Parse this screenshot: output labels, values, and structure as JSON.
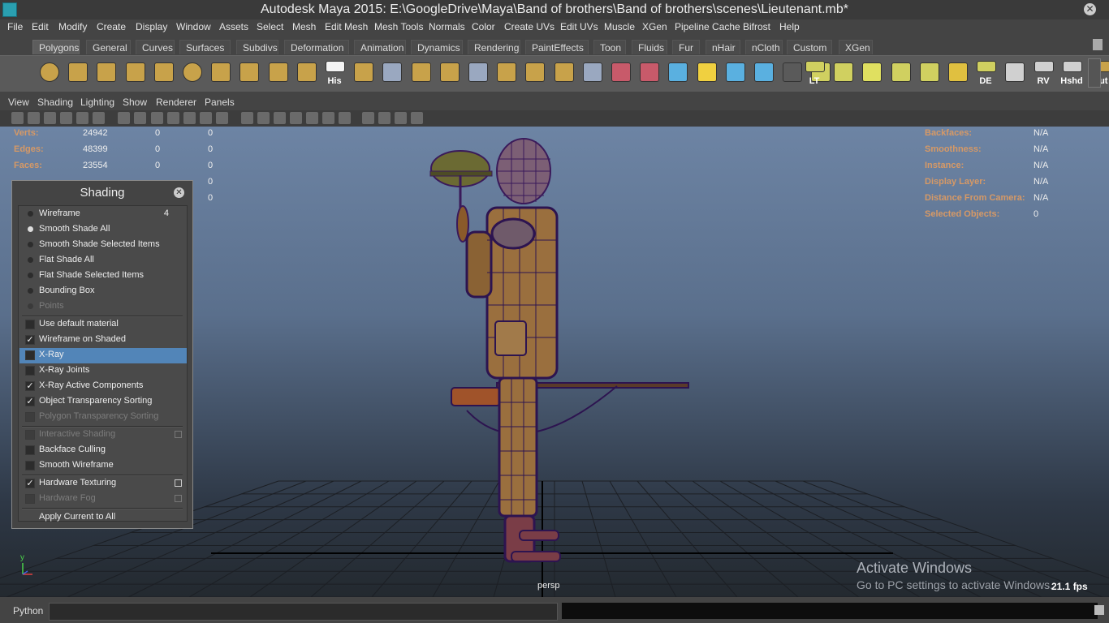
{
  "window": {
    "title": "Autodesk Maya 2015: E:\\GoogleDrive\\Maya\\Band of brothers\\Band of brothers\\scenes\\Lieutenant.mb*"
  },
  "menubar": [
    "File",
    "Edit",
    "Modify",
    "Create",
    "Display",
    "Window",
    "Assets",
    "Select",
    "Mesh",
    "Edit Mesh",
    "Mesh Tools",
    "Normals",
    "Color",
    "Create UVs",
    "Edit UVs",
    "Muscle",
    "XGen",
    "Pipeline Cache",
    "Bifrost",
    "Help"
  ],
  "shelf_tabs": {
    "active": "Polygons",
    "items": [
      "Polygons",
      "General",
      "Curves",
      "Surfaces",
      "Subdivs",
      "Deformation",
      "Animation",
      "Dynamics",
      "Rendering",
      "PaintEffects",
      "Toon",
      "Fluids",
      "Fur",
      "nHair",
      "nCloth",
      "Custom",
      "XGen"
    ]
  },
  "shelf_buttons": [
    {
      "icon": "poly-sphere-icon",
      "label": ""
    },
    {
      "icon": "poly-cube-icon",
      "label": ""
    },
    {
      "icon": "poly-cylinder-icon",
      "label": ""
    },
    {
      "icon": "poly-cone-icon",
      "label": ""
    },
    {
      "icon": "poly-plane-icon",
      "label": ""
    },
    {
      "icon": "poly-torus-icon",
      "label": ""
    },
    {
      "icon": "poly-pyramid-icon",
      "label": ""
    },
    {
      "icon": "poly-pipe-icon",
      "label": ""
    },
    {
      "icon": "create-polygon-icon",
      "label": ""
    },
    {
      "icon": "combine-icon",
      "label": ""
    },
    {
      "icon": "history-icon",
      "label": "His"
    },
    {
      "icon": "smooth-icon",
      "label": ""
    },
    {
      "icon": "extrude-icon",
      "label": ""
    },
    {
      "icon": "bridge-icon",
      "label": ""
    },
    {
      "icon": "append-icon",
      "label": ""
    },
    {
      "icon": "split-icon",
      "label": ""
    },
    {
      "icon": "insert-edge-loop-icon",
      "label": ""
    },
    {
      "icon": "offset-edge-icon",
      "label": ""
    },
    {
      "icon": "merge-icon",
      "label": ""
    },
    {
      "icon": "bevel-icon",
      "label": ""
    },
    {
      "icon": "poke-icon",
      "label": ""
    },
    {
      "icon": "wedge-icon",
      "label": ""
    },
    {
      "icon": "sculpt-icon",
      "label": ""
    },
    {
      "icon": "paint-icon",
      "label": ""
    },
    {
      "icon": "lattice-icon",
      "label": ""
    },
    {
      "icon": "pivot-icon",
      "label": ""
    },
    {
      "icon": "snap-icon",
      "label": ""
    },
    {
      "icon": "transfer-icon",
      "label": ""
    },
    {
      "icon": "lt-icon",
      "label": "LT"
    },
    {
      "icon": "uv-planar-icon",
      "label": ""
    },
    {
      "icon": "uv-cylindrical-icon",
      "label": ""
    },
    {
      "icon": "uv-spherical-icon",
      "label": ""
    },
    {
      "icon": "uv-auto-icon",
      "label": ""
    },
    {
      "icon": "uv-editor-icon",
      "label": ""
    },
    {
      "icon": "de-icon",
      "label": "DE"
    },
    {
      "icon": "uv-unfold-icon",
      "label": ""
    },
    {
      "icon": "rv-icon",
      "label": "RV"
    },
    {
      "icon": "hshd-icon",
      "label": "Hshd"
    },
    {
      "icon": "out-icon",
      "label": "Out"
    }
  ],
  "panel_menu": [
    "View",
    "Shading",
    "Lighting",
    "Show",
    "Renderer",
    "Panels"
  ],
  "hud_left": [
    {
      "label": "Verts:",
      "v1": "24942",
      "v2": "0",
      "v3": "0"
    },
    {
      "label": "Edges:",
      "v1": "48399",
      "v2": "0",
      "v3": "0"
    },
    {
      "label": "Faces:",
      "v1": "23554",
      "v2": "0",
      "v3": "0"
    },
    {
      "label": "",
      "v1": "",
      "v2": "",
      "v3": "0"
    },
    {
      "label": "",
      "v1": "",
      "v2": "",
      "v3": "0"
    }
  ],
  "hud_right": [
    {
      "label": "Backfaces:",
      "value": "N/A"
    },
    {
      "label": "Smoothness:",
      "value": "N/A"
    },
    {
      "label": "Instance:",
      "value": "N/A"
    },
    {
      "label": "Display Layer:",
      "value": "N/A"
    },
    {
      "label": "Distance From Camera:",
      "value": "N/A"
    },
    {
      "label": "Selected Objects:",
      "value": "0"
    }
  ],
  "shading_panel": {
    "title": "Shading",
    "radios": [
      {
        "label": "Wireframe",
        "hotkey": "4",
        "on": false,
        "disabled": false
      },
      {
        "label": "Smooth Shade All",
        "hotkey": "",
        "on": true,
        "disabled": false
      },
      {
        "label": "Smooth Shade Selected Items",
        "hotkey": "",
        "on": false,
        "disabled": false
      },
      {
        "label": "Flat Shade All",
        "hotkey": "",
        "on": false,
        "disabled": false
      },
      {
        "label": "Flat Shade Selected Items",
        "hotkey": "",
        "on": false,
        "disabled": false
      },
      {
        "label": "Bounding Box",
        "hotkey": "",
        "on": false,
        "disabled": false
      },
      {
        "label": "Points",
        "hotkey": "",
        "on": false,
        "disabled": true
      }
    ],
    "checks_a": [
      {
        "label": "Use default material",
        "checked": false,
        "disabled": false,
        "selected": false
      },
      {
        "label": "Wireframe on Shaded",
        "checked": true,
        "disabled": false,
        "selected": false
      },
      {
        "label": "X-Ray",
        "checked": false,
        "disabled": false,
        "selected": true
      },
      {
        "label": "X-Ray Joints",
        "checked": false,
        "disabled": false,
        "selected": false
      },
      {
        "label": "X-Ray Active Components",
        "checked": true,
        "disabled": false,
        "selected": false
      },
      {
        "label": "Object Transparency Sorting",
        "checked": true,
        "disabled": false,
        "selected": false
      },
      {
        "label": "Polygon Transparency Sorting",
        "checked": false,
        "disabled": true,
        "selected": false
      }
    ],
    "checks_b": [
      {
        "label": "Interactive Shading",
        "checked": false,
        "disabled": true,
        "option": true
      },
      {
        "label": "Backface Culling",
        "checked": false,
        "disabled": false,
        "option": false
      },
      {
        "label": "Smooth Wireframe",
        "checked": false,
        "disabled": false,
        "option": false
      }
    ],
    "checks_c": [
      {
        "label": "Hardware Texturing",
        "checked": true,
        "disabled": false,
        "option": true
      },
      {
        "label": "Hardware Fog",
        "checked": false,
        "disabled": true,
        "option": true
      }
    ],
    "apply": "Apply Current to All"
  },
  "viewport": {
    "camera": "persp",
    "fps": "21.1 fps",
    "axis_label": "y"
  },
  "watermark": {
    "heading": "Activate Windows",
    "sub": "Go to PC settings to activate Windows."
  },
  "command_line": {
    "label": "Python"
  }
}
